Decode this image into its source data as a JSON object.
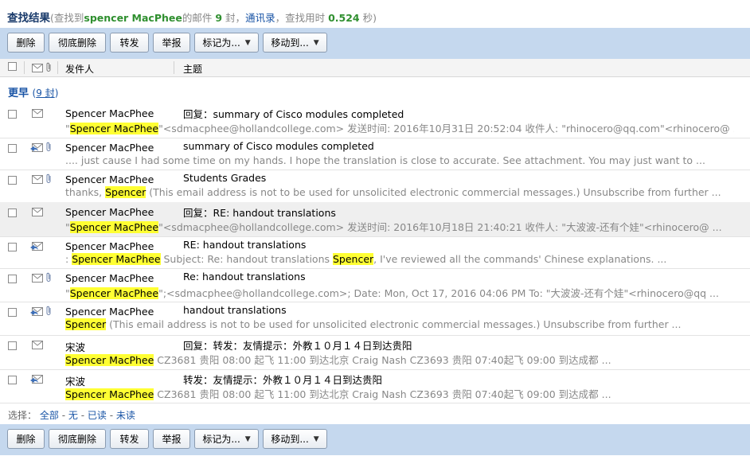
{
  "summary": {
    "title": "查找结果",
    "pre": "(查找到",
    "keyword": "spencer  MacPhee",
    "mid": "的邮件",
    "count": "9",
    "unit": "封，",
    "contacts_link": "通讯录",
    "time_pre": "，查找用时",
    "time": "0.524",
    "time_post": "秒)"
  },
  "toolbar": {
    "delete": "删除",
    "purge": "彻底删除",
    "forward": "转发",
    "report": "举报",
    "mark_as": "标记为...",
    "move_to": "移动到..."
  },
  "columns": {
    "sender": "发件人",
    "subject": "主题"
  },
  "group": {
    "label": "更早",
    "count_open": "(",
    "count": "9 封",
    "count_close": ")"
  },
  "rows": [
    {
      "sender": "Spencer MacPhee",
      "subject": "回复：summary of Cisco modules completed",
      "snip_pre": "\"",
      "snip_hl": "Spencer MacPhee",
      "snip_post": "\"<sdmacphee@hollandcollege.com> 发送时间: 2016年10月31日 20:52:04 收件人: \"rhinocero@qq.com\"<rhinocero@ ...",
      "icon": "envelope-read",
      "attachment": false
    },
    {
      "sender": "Spencer MacPhee",
      "subject": "summary of Cisco modules completed",
      "snip_pre": ".... just cause I had some time on my hands. I hope the translation is close to accurate. See attachment. You may just want to ...",
      "icon": "envelope-replied",
      "attachment": true
    },
    {
      "sender": "Spencer MacPhee",
      "subject": "Students Grades",
      "snip_pre": "thanks, ",
      "snip_hl": "Spencer",
      "snip_post": " (This email address is not to be used for unsolicited electronic commercial messages.) Unsubscribe from further ...",
      "icon": "envelope-read",
      "attachment": true
    },
    {
      "sender": "Spencer MacPhee",
      "subject": "回复：RE: handout translations",
      "snip_pre": "\"",
      "snip_hl": "Spencer MacPhee",
      "snip_post": "\"<sdmacphee@hollandcollege.com> 发送时间: 2016年10月18日 21:40:21 收件人: \"大波波-还有个娃\"<rhinocero@ ...",
      "icon": "envelope-read",
      "attachment": false,
      "selected": true
    },
    {
      "sender": "Spencer MacPhee",
      "subject": "RE: handout translations",
      "snip_pre": ": ",
      "snip_hl": "Spencer MacPhee",
      "snip_post": " Subject: Re: handout translations ",
      "snip_hl2": "Spencer",
      "snip_post2": ", I've reviewed all the commands' Chinese explanations. ...",
      "icon": "envelope-replied",
      "attachment": false
    },
    {
      "sender": "Spencer MacPhee",
      "subject": "Re: handout translations",
      "snip_pre": "\"",
      "snip_hl": "Spencer MacPhee",
      "snip_post": "\";<sdmacphee@hollandcollege.com>; Date: Mon, Oct 17, 2016 04:06 PM To: \"大波波-还有个娃\"<rhinocero@qq ...",
      "icon": "envelope-read",
      "attachment": true
    },
    {
      "sender": "Spencer MacPhee",
      "subject": "handout translations",
      "snip_pre": "",
      "snip_hl": "Spencer",
      "snip_post": " (This email address is not to be used for unsolicited electronic commercial messages.) Unsubscribe from further ...",
      "icon": "envelope-replied",
      "attachment": true
    },
    {
      "sender": "宋波",
      "subject": "回复：转发：友情提示：外教１０月１４日到达贵阳",
      "snip_pre": "",
      "snip_hl": "Spencer MacPhee",
      "snip_post": " CZ3681 贵阳 08:00 起飞 11:00 到达北京 Craig Nash CZ3693 贵阳 07:40起飞 09:00 到达成都 ...",
      "icon": "envelope-read",
      "attachment": false
    },
    {
      "sender": "宋波",
      "subject": "转发：友情提示：外教１０月１４日到达贵阳",
      "snip_pre": "",
      "snip_hl": "Spencer MacPhee",
      "snip_post": " CZ3681 贵阳 08:00 起飞 11:00 到达北京 Craig Nash CZ3693 贵阳 07:40起飞 09:00 到达成都 ...",
      "icon": "envelope-replied",
      "attachment": false
    }
  ],
  "footer": {
    "select_label": "选择：",
    "all": "全部",
    "none": "无",
    "read": "已读",
    "unread": "未读"
  },
  "colors": {
    "toolbar_bg": "#c5d8ee",
    "highlight": "#ffff33",
    "link": "#1a55a6",
    "keyword_green": "#2f8f2f"
  }
}
